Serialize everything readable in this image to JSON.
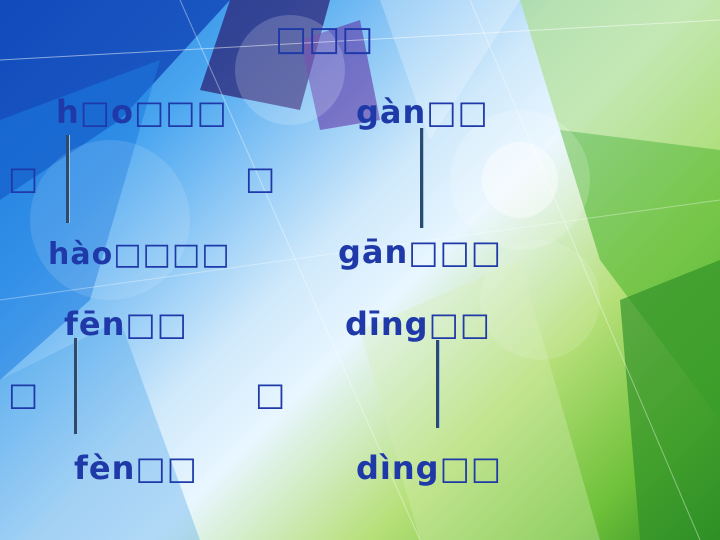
{
  "slide": {
    "title": "□□□",
    "rows": {
      "r1_left": "h□o□□□",
      "r1_right": "gàn□□",
      "r2_left": "□",
      "r2_mid": "□",
      "r3_left": "hào□□□□",
      "r3_right": "gān□□□",
      "r4_left": "fēn□□",
      "r4_right": "dīng□□",
      "r5_left": "□",
      "r5_mid": "□",
      "r6_left": "fèn□□",
      "r6_right": "dìng□□"
    }
  }
}
